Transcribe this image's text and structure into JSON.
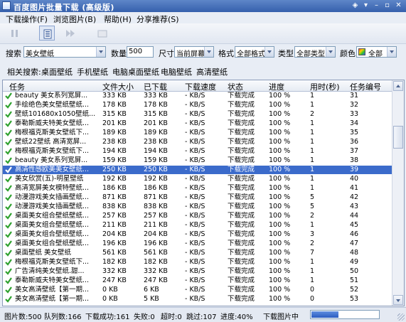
{
  "window": {
    "title": "百度图片批量下载 (高级版)",
    "controls": [
      "◈",
      "▾",
      "–",
      "▫",
      "✕"
    ]
  },
  "menu": [
    "下载操作(F)",
    "浏览图片(B)",
    "帮助(H)",
    "分享推荐(S)"
  ],
  "filters": {
    "search_label": "搜索",
    "search_value": "美女壁纸",
    "count_label": "数量",
    "count_value": "500",
    "size_label": "尺寸",
    "size_value": "当前屏幕",
    "format_label": "格式",
    "format_value": "全部格式",
    "type_label": "类型",
    "type_value": "全部类型",
    "color_label": "颜色",
    "color_value": "全部"
  },
  "related": {
    "label": "相关搜索:",
    "links": [
      "桌面壁纸",
      "手机壁纸",
      "电脑桌面壁纸",
      "电脑壁纸",
      "高清壁纸"
    ]
  },
  "table": {
    "columns": [
      "任务",
      "文件大小",
      "已下载",
      "下载速度",
      "状态",
      "进度",
      "用时(秒)",
      "任务编号"
    ],
    "selected_index": 8,
    "rows": [
      [
        "beauty 美女系列宽屏...",
        "333 KB",
        "333 KB",
        "- KB/S",
        "下载完成",
        "100 %",
        "1",
        "31"
      ],
      [
        "手绘绝色美女壁纸壁纸...",
        "178 KB",
        "178 KB",
        "- KB/S",
        "下载完成",
        "100 %",
        "1",
        "32"
      ],
      [
        "壁纸101680x1050壁纸...",
        "315 KB",
        "315 KB",
        "- KB/S",
        "下载完成",
        "100 %",
        "2",
        "33"
      ],
      [
        "泰勒斯威夫特美女壁纸...",
        "201 KB",
        "201 KB",
        "- KB/S",
        "下载完成",
        "100 %",
        "1",
        "34"
      ],
      [
        "梅根福克斯美女壁纸下...",
        "189 KB",
        "189 KB",
        "- KB/S",
        "下载完成",
        "100 %",
        "1",
        "35"
      ],
      [
        "壁纸22壁纸 高清宽屏...",
        "238 KB",
        "238 KB",
        "- KB/S",
        "下载完成",
        "100 %",
        "1",
        "36"
      ],
      [
        "梅根福克斯美女壁纸下...",
        "194 KB",
        "194 KB",
        "- KB/S",
        "下载完成",
        "100 %",
        "1",
        "37"
      ],
      [
        "beauty 美女系列宽屏...",
        "159 KB",
        "159 KB",
        "- KB/S",
        "下载完成",
        "100 %",
        "1",
        "38"
      ],
      [
        "高清性感欧美美女壁纸...",
        "250 KB",
        "250 KB",
        "- KB/S",
        "下载完成",
        "100 %",
        "1",
        "39"
      ],
      [
        "美女欣赏(五)-明星壁纸",
        "192 KB",
        "192 KB",
        "- KB/S",
        "下载完成",
        "100 %",
        "1",
        "40"
      ],
      [
        "高清宽屏美女模特壁纸...",
        "186 KB",
        "186 KB",
        "- KB/S",
        "下载完成",
        "100 %",
        "1",
        "41"
      ],
      [
        "动漫游戏美女插画壁纸...",
        "871 KB",
        "871 KB",
        "- KB/S",
        "下载完成",
        "100 %",
        "5",
        "42"
      ],
      [
        "动漫游戏美女插画壁纸...",
        "838 KB",
        "838 KB",
        "- KB/S",
        "下载完成",
        "100 %",
        "5",
        "43"
      ],
      [
        "桌面美女组合壁纸壁纸...",
        "257 KB",
        "257 KB",
        "- KB/S",
        "下载完成",
        "100 %",
        "2",
        "44"
      ],
      [
        "桌面美女组合壁纸壁纸...",
        "211 KB",
        "211 KB",
        "- KB/S",
        "下载完成",
        "100 %",
        "1",
        "45"
      ],
      [
        "桌面美女组合壁纸壁纸...",
        "204 KB",
        "204 KB",
        "- KB/S",
        "下载完成",
        "100 %",
        "3",
        "46"
      ],
      [
        "桌面美女组合壁纸壁纸...",
        "196 KB",
        "196 KB",
        "- KB/S",
        "下载完成",
        "100 %",
        "2",
        "47"
      ],
      [
        "桌面壁纸 美女壁纸",
        "561 KB",
        "561 KB",
        "- KB/S",
        "下载完成",
        "100 %",
        "7",
        "48"
      ],
      [
        "梅根福克斯美女壁纸下...",
        "182 KB",
        "182 KB",
        "- KB/S",
        "下载完成",
        "100 %",
        "1",
        "49"
      ],
      [
        "广告清纯美女壁纸.甜...",
        "332 KB",
        "332 KB",
        "- KB/S",
        "下载完成",
        "100 %",
        "1",
        "50"
      ],
      [
        "泰勒斯威夫特美女壁纸...",
        "247 KB",
        "247 KB",
        "- KB/S",
        "下载完成",
        "100 %",
        "1",
        "51"
      ],
      [
        "美女高清壁纸【第一期...",
        "0 KB",
        "6 KB",
        "- KB/S",
        "下载完成",
        "100 %",
        "0",
        "52"
      ],
      [
        "美女高清壁纸【第一期...",
        "0 KB",
        "5 KB",
        "- KB/S",
        "下载完成",
        "100 %",
        "0",
        "53"
      ]
    ]
  },
  "status": {
    "total": "图片数:500",
    "queue": "队列数:166",
    "success": "下载成功:161",
    "fail": "失败:0",
    "timeout": "超时:0",
    "skipped": "跳过:107",
    "progress_text": "进度:40%",
    "state": "下载图片中",
    "progress": 0.4
  }
}
